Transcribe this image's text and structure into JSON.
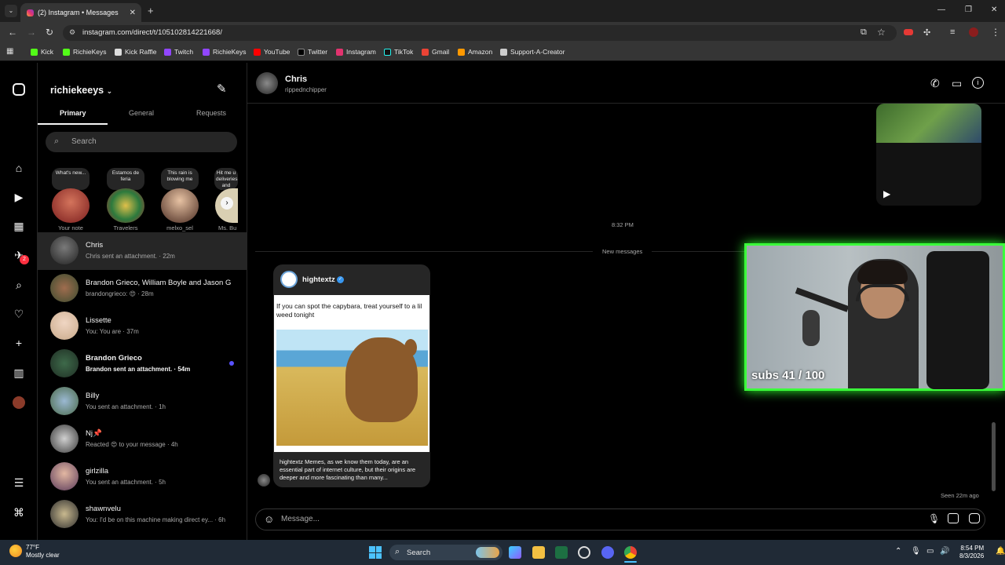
{
  "browser": {
    "tab_title": "(2) Instagram • Messages",
    "url": "instagram.com/direct/t/105102814221668/",
    "bookmarks": [
      "Kick",
      "RichieKeys",
      "Kick Raffle",
      "Twitch",
      "RichieKeys",
      "YouTube",
      "Twitter",
      "Instagram",
      "TikTok",
      "Gmail",
      "Amazon",
      "Support-A-Creator"
    ]
  },
  "inbox": {
    "username": "richiekeeys",
    "tabs": [
      "Primary",
      "General",
      "Requests"
    ],
    "search_placeholder": "Search",
    "notes": [
      {
        "text": "What's new...",
        "label": "Your note"
      },
      {
        "text": "Estamos de feria",
        "label": "Travelers"
      },
      {
        "text": "This rain is blowing me",
        "label": "melxo_sel"
      },
      {
        "text": "Hit me u deliveries and tomo",
        "label": "Ms. Bu"
      }
    ],
    "threads": [
      {
        "name": "Chris",
        "meta": "Chris sent an attachment. · 22m"
      },
      {
        "name": "Brandon Grieco, William Boyle and Jason G",
        "meta": "brandongrieco: 😍 · 28m"
      },
      {
        "name": "Lissette",
        "meta": "You: You are · 37m"
      },
      {
        "name": "Brandon Grieco",
        "meta": "Brandon sent an attachment. · 54m"
      },
      {
        "name": "Billy",
        "meta": "You sent an attachment. · 1h"
      },
      {
        "name": "Nj📌",
        "meta": "Reacted 😍 to your message · 4h"
      },
      {
        "name": "girlzilla",
        "meta": "You sent an attachment. · 5h"
      },
      {
        "name": "shawnvelu",
        "meta": "You: I'd be on this machine making direct ey... · 6h"
      }
    ]
  },
  "chat": {
    "name": "Chris",
    "handle": "rippednchipper",
    "timestamp": "8:32 PM",
    "new_messages": "New messages",
    "post": {
      "account": "hightextz",
      "text": "If you can spot the capybara, treat yourself to a lil weed tonight",
      "caption": "hightextz Memes, as we know them today, are an essential part of internet culture, but their origins are deeper and more fascinating than many..."
    },
    "seen": "Seen 22m ago",
    "message_placeholder": "Message..."
  },
  "overlay": {
    "subs": "subs 41 / 100"
  },
  "taskbar": {
    "temp": "77°F",
    "weather": "Mostly clear",
    "search": "Search",
    "time": "8:54 PM",
    "date": "8/3/2026"
  }
}
